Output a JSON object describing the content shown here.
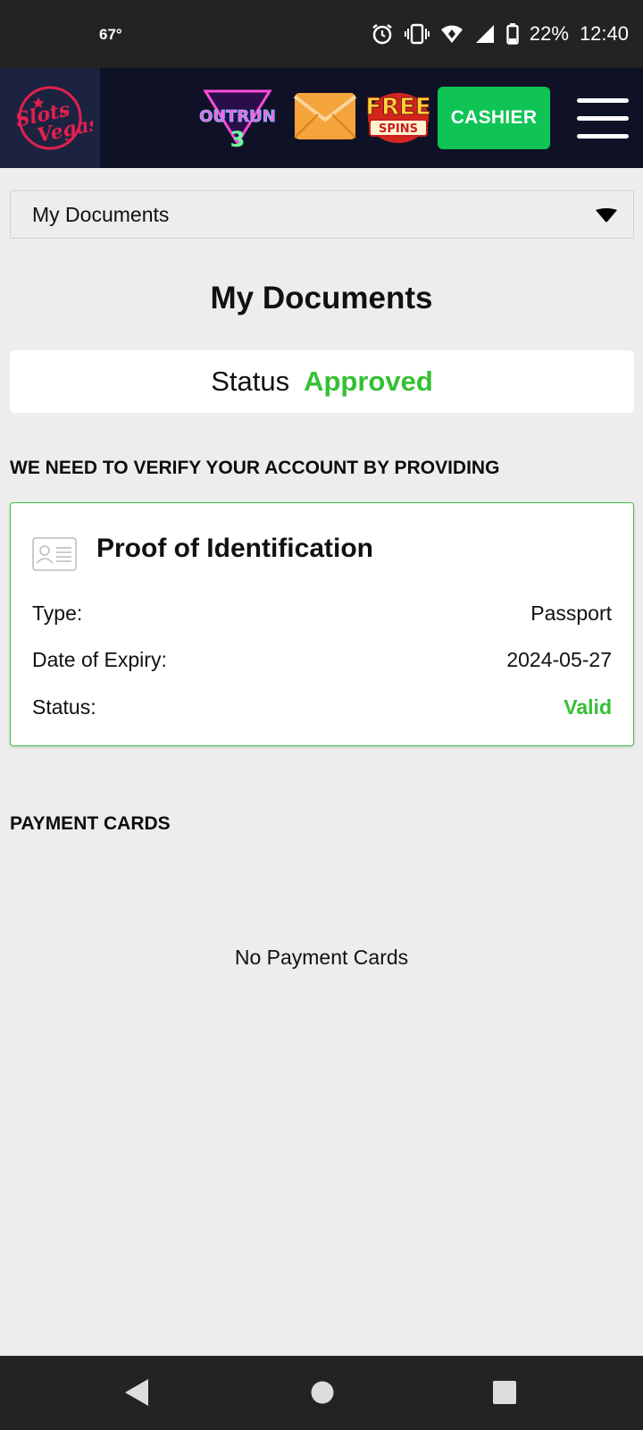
{
  "statusbar": {
    "temperature": "67°",
    "battery": "22%",
    "time": "12:40",
    "icons": [
      "alarm-icon",
      "vibrate-icon",
      "wifi-icon",
      "signal-icon",
      "battery-icon"
    ]
  },
  "header": {
    "logo_text": "Slots of Vegas",
    "promo_icons": [
      "outrun-3-game-icon",
      "mail-icon",
      "free-spins-icon"
    ],
    "free_text": "FREE",
    "spins_text": "SPINS",
    "outrun_text": "OUTRUN",
    "outrun_num": "3",
    "cashier_label": "CASHIER",
    "colors": {
      "cashier": "#0fc455",
      "header_bg": "#0f1226",
      "logo_bg": "#1b2340"
    }
  },
  "dropdown": {
    "selected": "My Documents"
  },
  "page": {
    "title": "My Documents",
    "status_label": "Status",
    "status_value": "Approved",
    "verify_heading": "WE NEED TO VERIFY YOUR ACCOUNT BY PROVIDING",
    "colors": {
      "approved": "#35c035",
      "card_border": "#3fc43f"
    }
  },
  "id_card": {
    "title": "Proof of Identification",
    "rows": [
      {
        "label": "Type:",
        "value": "Passport"
      },
      {
        "label": "Date of Expiry:",
        "value": "2024-05-27"
      },
      {
        "label": "Status:",
        "value": "Valid"
      }
    ]
  },
  "payment": {
    "heading": "PAYMENT CARDS",
    "empty_text": "No Payment Cards"
  }
}
